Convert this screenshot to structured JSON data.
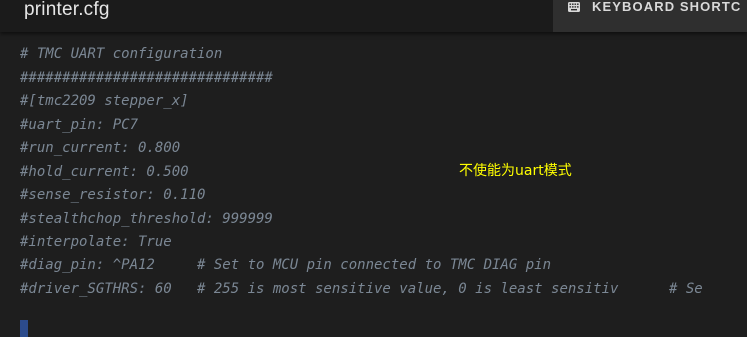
{
  "window": {
    "title": "printer.cfg"
  },
  "toolbar": {
    "keyboard_shortcuts_label": "KEYBOARD SHORTC",
    "keyboard_icon": "keyboard-icon"
  },
  "editor": {
    "lines": [
      "##############################",
      "# TMC UART configuration",
      "##############################",
      "#[tmc2209 stepper_x]",
      "#uart_pin: PC7",
      "#run_current: 0.800",
      "#hold_current: 0.500",
      "#sense_resistor: 0.110",
      "#stealthchop_threshold: 999999",
      "#interpolate: True",
      "#diag_pin: ^PA12     # Set to MCU pin connected to TMC DIAG pin",
      "#driver_SGTHRS: 60   # 255 is most sensitive value, 0 is least sensitiv      # Se"
    ],
    "annotation": "不使能为uart模式",
    "colors": {
      "background": "#1e1e1e",
      "comment": "#7b8794",
      "annotation": "#ffff00",
      "cursor": "#2c4b8c"
    }
  }
}
